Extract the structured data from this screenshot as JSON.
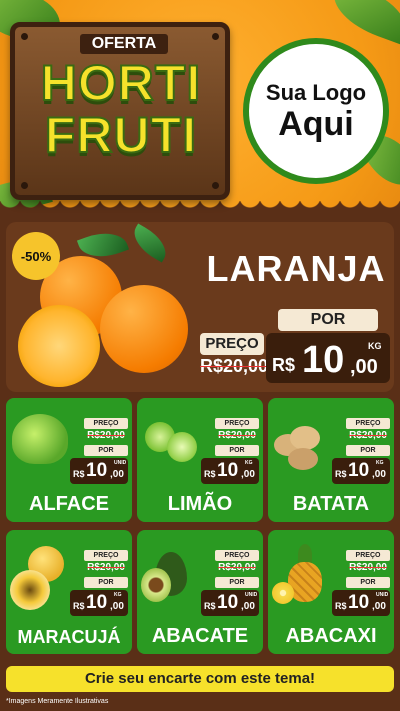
{
  "header": {
    "oferta": "OFERTA",
    "title_line1": "HORTI",
    "title_line2": "FRUTI",
    "logo_line1": "Sua Logo",
    "logo_line2": "Aqui"
  },
  "featured": {
    "discount": "-50%",
    "name": "LARANJA",
    "preco_label": "PREÇO",
    "old_price": "R$20,00",
    "por_label": "POR",
    "currency": "R$",
    "price_int": "10",
    "price_dec": ",00",
    "unit": "KG"
  },
  "products": [
    {
      "name": "ALFACE",
      "preco_label": "PREÇO",
      "old_price": "R$20,00",
      "por_label": "POR",
      "currency": "R$",
      "price_int": "10",
      "price_dec": ",00",
      "unit": "UNID",
      "icon": "lettuce-icon"
    },
    {
      "name": "LIMÃO",
      "preco_label": "PREÇO",
      "old_price": "R$20,00",
      "por_label": "POR",
      "currency": "R$",
      "price_int": "10",
      "price_dec": ",00",
      "unit": "KG",
      "icon": "lime-icon"
    },
    {
      "name": "BATATA",
      "preco_label": "PREÇO",
      "old_price": "R$20,00",
      "por_label": "POR",
      "currency": "R$",
      "price_int": "10",
      "price_dec": ",00",
      "unit": "KG",
      "icon": "potato-icon"
    },
    {
      "name": "MARACUJÁ",
      "preco_label": "PREÇO",
      "old_price": "R$20,00",
      "por_label": "POR",
      "currency": "R$",
      "price_int": "10",
      "price_dec": ",00",
      "unit": "KG",
      "icon": "passion-fruit-icon"
    },
    {
      "name": "ABACATE",
      "preco_label": "PREÇO",
      "old_price": "R$20,00",
      "por_label": "POR",
      "currency": "R$",
      "price_int": "10",
      "price_dec": ",00",
      "unit": "UNID",
      "icon": "avocado-icon"
    },
    {
      "name": "ABACAXI",
      "preco_label": "PREÇO",
      "old_price": "R$20,00",
      "por_label": "POR",
      "currency": "R$",
      "price_int": "10",
      "price_dec": ",00",
      "unit": "UNID",
      "icon": "pineapple-icon"
    }
  ],
  "cta": "Crie seu encarte com este tema!",
  "footnote": "*Imagens Meramente Ilustrativas",
  "colors": {
    "orange_bg": "#f59a16",
    "wood": "#5a2f17",
    "green_tile": "#2a9a22",
    "title_yellow": "#f6e22b",
    "cta_yellow": "#f6e12b"
  }
}
